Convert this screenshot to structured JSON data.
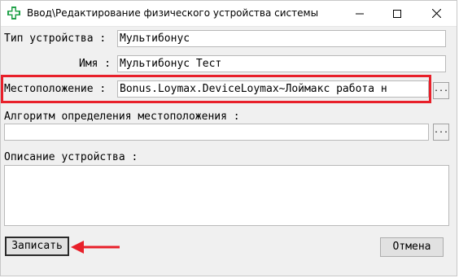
{
  "window": {
    "title": "Ввод\\Редактирование физического устройства системы",
    "controls": {
      "minimize": "–",
      "maximize": "□",
      "close": "✕"
    }
  },
  "form": {
    "device_type_label": "Тип устройства :",
    "device_type_value": "Мультибонус",
    "name_label": "Имя :",
    "name_value": "Мультибонус Тест",
    "location_label": "Местоположение :",
    "location_value": "Bonus.Loymax.DeviceLoymax~Лоймакс работа н",
    "location_browse": "...",
    "algorithm_label": "Алгоритм определения местоположения :",
    "algorithm_value": "",
    "algorithm_browse": "...",
    "description_label": "Описание устройства :",
    "description_value": ""
  },
  "buttons": {
    "save": "Записать",
    "cancel": "Отмена"
  },
  "colors": {
    "highlight": "#e8202a",
    "icon_green": "#22a24a"
  }
}
